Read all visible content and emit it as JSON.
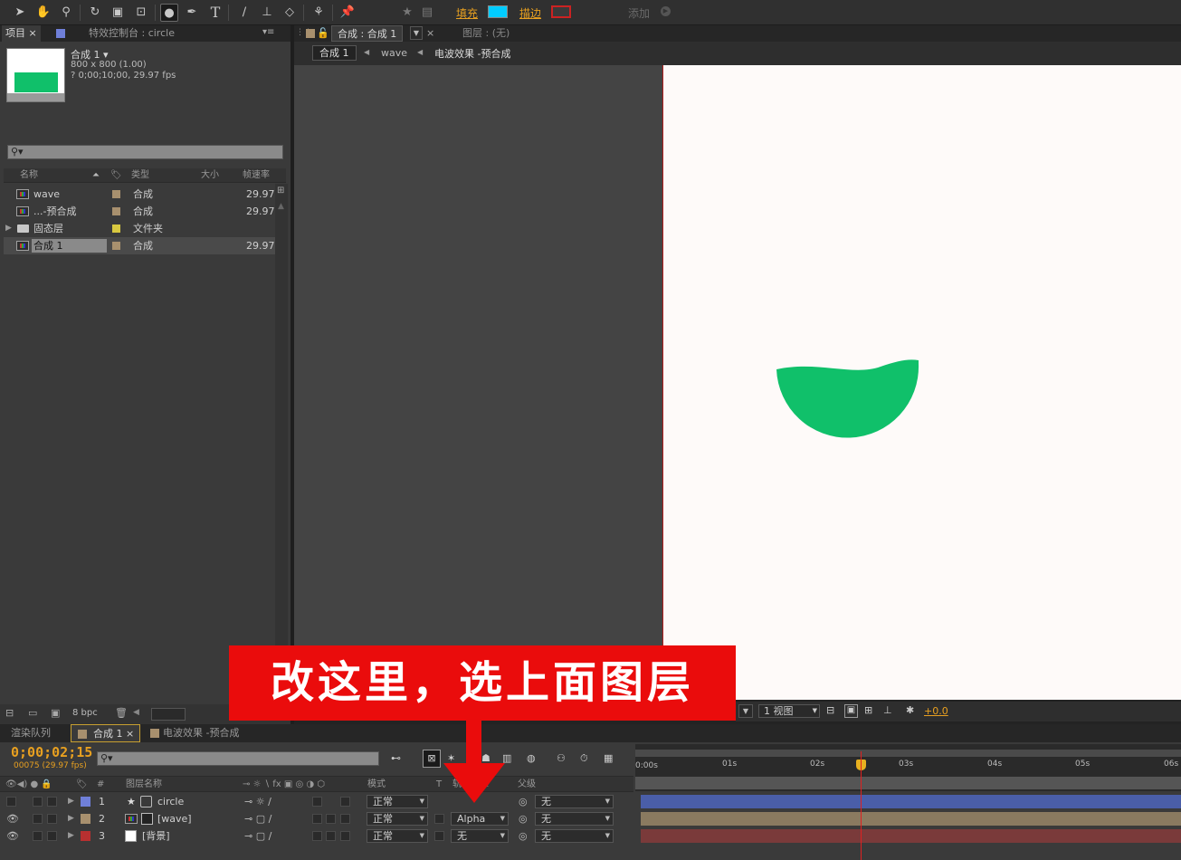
{
  "toolbar": {
    "fill_label": "填充",
    "stroke_label": "描边",
    "add_label": "添加",
    "fill_color": "#00ccff",
    "stroke_color": "#cc2222"
  },
  "project_panel": {
    "tab_label": "项目",
    "effects_tab_label": "特效控制台 : circle",
    "preview_name": "合成 1 ▾",
    "preview_size": "800 x 800 (1.00)",
    "preview_info": "? 0;00;10;00, 29.97 fps",
    "search_placeholder": "",
    "columns": {
      "name": "名称",
      "type": "类型",
      "size": "大小",
      "fps": "帧速率"
    },
    "items": [
      {
        "name": "wave",
        "type": "合成",
        "fps": "29.97",
        "icon": "composition-icon",
        "color": "#a8906e"
      },
      {
        "name": "...-预合成",
        "type": "合成",
        "fps": "29.97",
        "icon": "composition-icon",
        "color": "#a8906e"
      },
      {
        "name": "固态层",
        "type": "文件夹",
        "fps": "",
        "icon": "folder-icon",
        "color": "#d8c840"
      },
      {
        "name": "合成 1",
        "type": "合成",
        "fps": "29.97",
        "icon": "composition-icon",
        "color": "#a8906e"
      }
    ],
    "bpc_label": "8 bpc"
  },
  "comp_viewer": {
    "tab_label": "合成 : 合成 1",
    "layer_tab_label": "图层 : (无)",
    "breadcrumbs": [
      "合成 1",
      "wave",
      "电波效果 -预合成"
    ],
    "view_count": "1 视图",
    "exposure": "+0.0"
  },
  "annotation": {
    "text": "改这里，选上面图层"
  },
  "timeline": {
    "tabs": [
      "渲染队列",
      "合成 1",
      "电波效果 -预合成"
    ],
    "timecode": "0;00;02;15",
    "frame_info": "00075 (29.97 fps)",
    "columns": {
      "num": "#",
      "layer_name": "图层名称",
      "mode": "模式",
      "t": "T",
      "trkmat": "轨道遮罩",
      "parent": "父级"
    },
    "layers": [
      {
        "num": "1",
        "name": "circle",
        "color": "#6f7fd8",
        "mode": "正常",
        "trkmat": "",
        "parent": "无",
        "bar_color": "#4a5ea8"
      },
      {
        "num": "2",
        "name": "[wave]",
        "color": "#a8906e",
        "mode": "正常",
        "trkmat": "Alpha",
        "parent": "无",
        "bar_color": "#8a7a60"
      },
      {
        "num": "3",
        "name": "[背景]",
        "color": "#b83030",
        "mode": "正常",
        "trkmat": "无",
        "parent": "无",
        "bar_color": "#7a3a3a"
      }
    ],
    "ruler_ticks": [
      "0:00s",
      "01s",
      "02s",
      "03s",
      "04s",
      "05s",
      "06s"
    ]
  }
}
